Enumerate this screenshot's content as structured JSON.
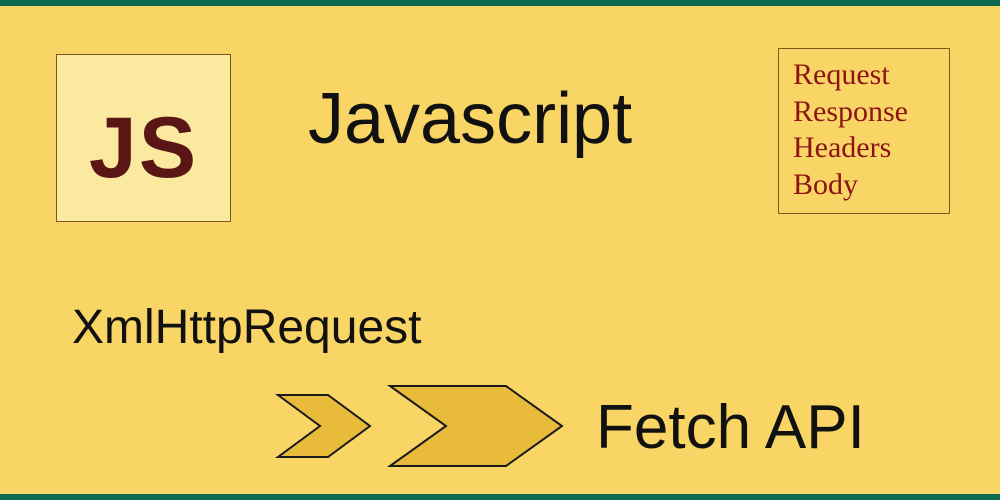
{
  "badge": {
    "label": "JS"
  },
  "title": "Javascript",
  "api_box": {
    "items": [
      "Request",
      "Response",
      "Headers",
      "Body"
    ]
  },
  "old_api": "XmlHttpRequest",
  "new_api": "Fetch API",
  "colors": {
    "bg": "#f8d564",
    "accent_bar": "#0b6a4f",
    "badge_bg": "#fbe9a0",
    "badge_border": "#7a5a1a",
    "badge_text": "#5a1515",
    "api_text": "#8d1414",
    "arrow_fill": "#e8bb3a",
    "arrow_stroke": "#1a1a1a"
  }
}
